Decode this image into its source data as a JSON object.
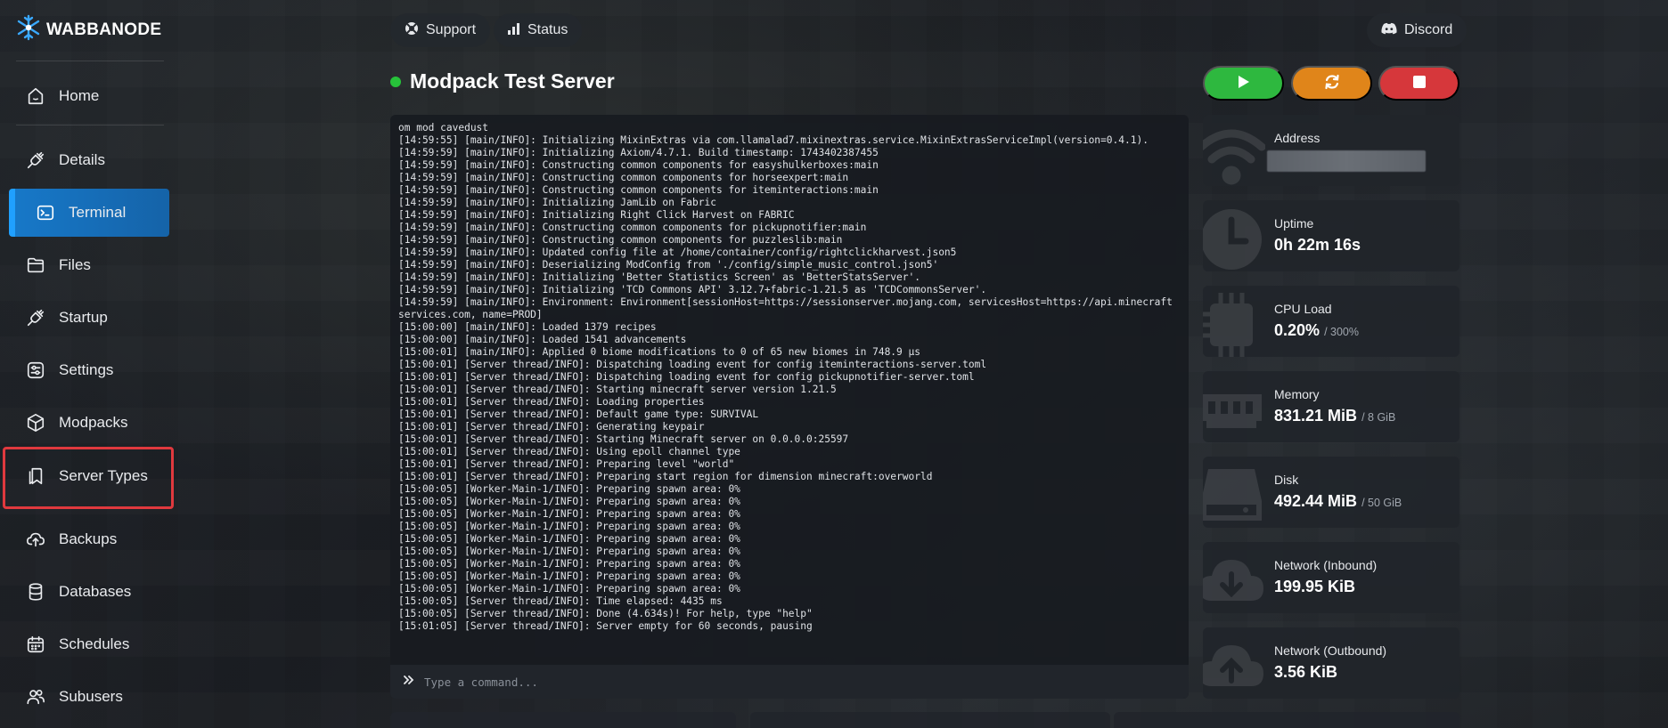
{
  "brand": {
    "name": "WABBANODE"
  },
  "sidebar": {
    "items": [
      {
        "label": "Home",
        "icon": "home-icon"
      },
      {
        "label": "Details",
        "icon": "plug-icon"
      },
      {
        "label": "Terminal",
        "icon": "terminal-icon",
        "active": true
      },
      {
        "label": "Files",
        "icon": "folder-icon"
      },
      {
        "label": "Startup",
        "icon": "plug-icon"
      },
      {
        "label": "Settings",
        "icon": "sliders-icon"
      },
      {
        "label": "Modpacks",
        "icon": "cube-icon"
      },
      {
        "label": "Server Types",
        "icon": "bookmarks-icon",
        "highlighted": true
      },
      {
        "label": "Backups",
        "icon": "cloud-upload-icon"
      },
      {
        "label": "Databases",
        "icon": "database-icon"
      },
      {
        "label": "Schedules",
        "icon": "calendar-icon"
      },
      {
        "label": "Subusers",
        "icon": "users-icon"
      }
    ]
  },
  "topbar": {
    "support_label": "Support",
    "status_label": "Status",
    "discord_label": "Discord"
  },
  "server": {
    "title": "Modpack Test Server",
    "status_color": "#27c33a"
  },
  "controls": {
    "start_color": "#2eb83f",
    "restart_color": "#e0851a",
    "stop_color": "#d6373b"
  },
  "terminal": {
    "lines": [
      "om mod cavedust",
      "[14:59:55] [main/INFO]: Initializing MixinExtras via com.llamalad7.mixinextras.service.MixinExtrasServiceImpl(version=0.4.1).",
      "[14:59:59] [main/INFO]: Initializing Axiom/4.7.1. Build timestamp: 1743402387455",
      "[14:59:59] [main/INFO]: Constructing common components for easyshulkerboxes:main",
      "[14:59:59] [main/INFO]: Constructing common components for horseexpert:main",
      "[14:59:59] [main/INFO]: Constructing common components for iteminteractions:main",
      "[14:59:59] [main/INFO]: Initializing JamLib on Fabric",
      "[14:59:59] [main/INFO]: Initializing Right Click Harvest on FABRIC",
      "[14:59:59] [main/INFO]: Constructing common components for pickupnotifier:main",
      "[14:59:59] [main/INFO]: Constructing common components for puzzleslib:main",
      "[14:59:59] [main/INFO]: Updated config file at /home/container/config/rightclickharvest.json5",
      "[14:59:59] [main/INFO]: Deserializing ModConfig from './config/simple_music_control.json5'",
      "[14:59:59] [main/INFO]: Initializing 'Better Statistics Screen' as 'BetterStatsServer'.",
      "[14:59:59] [main/INFO]: Initializing 'TCD Commons API' 3.12.7+fabric-1.21.5 as 'TCDCommonsServer'.",
      "[14:59:59] [main/INFO]: Environment: Environment[sessionHost=https://sessionserver.mojang.com, servicesHost=https://api.minecraftservices.com, name=PROD]",
      "[15:00:00] [main/INFO]: Loaded 1379 recipes",
      "[15:00:00] [main/INFO]: Loaded 1541 advancements",
      "[15:00:01] [main/INFO]: Applied 0 biome modifications to 0 of 65 new biomes in 748.9 μs",
      "[15:00:01] [Server thread/INFO]: Dispatching loading event for config iteminteractions-server.toml",
      "[15:00:01] [Server thread/INFO]: Dispatching loading event for config pickupnotifier-server.toml",
      "[15:00:01] [Server thread/INFO]: Starting minecraft server version 1.21.5",
      "[15:00:01] [Server thread/INFO]: Loading properties",
      "[15:00:01] [Server thread/INFO]: Default game type: SURVIVAL",
      "[15:00:01] [Server thread/INFO]: Generating keypair",
      "[15:00:01] [Server thread/INFO]: Starting Minecraft server on 0.0.0.0:25597",
      "[15:00:01] [Server thread/INFO]: Using epoll channel type",
      "[15:00:01] [Server thread/INFO]: Preparing level \"world\"",
      "[15:00:01] [Server thread/INFO]: Preparing start region for dimension minecraft:overworld",
      "[15:00:05] [Worker-Main-1/INFO]: Preparing spawn area: 0%",
      "[15:00:05] [Worker-Main-1/INFO]: Preparing spawn area: 0%",
      "[15:00:05] [Worker-Main-1/INFO]: Preparing spawn area: 0%",
      "[15:00:05] [Worker-Main-1/INFO]: Preparing spawn area: 0%",
      "[15:00:05] [Worker-Main-1/INFO]: Preparing spawn area: 0%",
      "[15:00:05] [Worker-Main-1/INFO]: Preparing spawn area: 0%",
      "[15:00:05] [Worker-Main-1/INFO]: Preparing spawn area: 0%",
      "[15:00:05] [Worker-Main-1/INFO]: Preparing spawn area: 0%",
      "[15:00:05] [Worker-Main-1/INFO]: Preparing spawn area: 0%",
      "[15:00:05] [Server thread/INFO]: Time elapsed: 4435 ms",
      "[15:00:05] [Server thread/INFO]: Done (4.634s)! For help, type \"help\"",
      "[15:01:05] [Server thread/INFO]: Server empty for 60 seconds, pausing"
    ],
    "command_placeholder": "Type a command..."
  },
  "stats": {
    "address": {
      "label": "Address"
    },
    "uptime": {
      "label": "Uptime",
      "value": "0h 22m 16s"
    },
    "cpu": {
      "label": "CPU Load",
      "value": "0.20%",
      "sub": "/ 300%"
    },
    "memory": {
      "label": "Memory",
      "value": "831.21 MiB",
      "sub": "/ 8 GiB"
    },
    "disk": {
      "label": "Disk",
      "value": "492.44 MiB",
      "sub": "/ 50 GiB"
    },
    "net_in": {
      "label": "Network (Inbound)",
      "value": "199.95 KiB"
    },
    "net_out": {
      "label": "Network (Outbound)",
      "value": "3.56 KiB"
    }
  }
}
